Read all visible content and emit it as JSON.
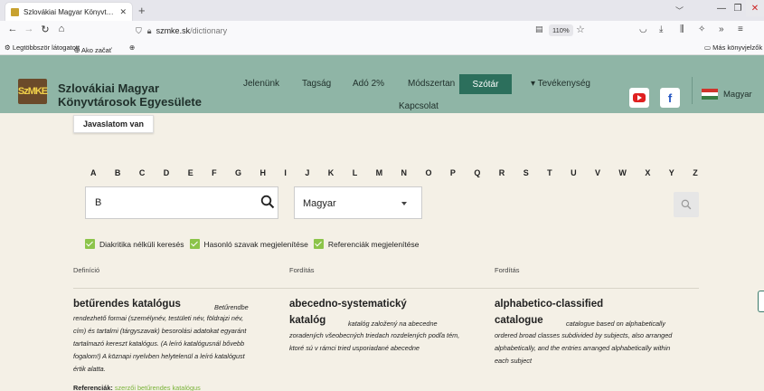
{
  "browser": {
    "tab_title": "Szlovákiai Magyar Könyvtárosok Egyesülete",
    "url_host": "szmke.sk",
    "url_path": "/dictionary",
    "zoom": "110%",
    "bookmarks": [
      "Legtöbbször látogatott",
      "Ako začať",
      "Más könyvjelzők"
    ]
  },
  "site": {
    "logo_text": "SzMKE",
    "name_line1": "Szlovákiai Magyar",
    "name_line2": "Könyvtárosok Egyesülete",
    "menu": {
      "jelenunk": "Jelenünk",
      "tagsag": "Tagság",
      "ado": "Adó 2%",
      "modszertan": "Módszertan",
      "szotar": "Szótár",
      "tevekenyseg": "▾ Tevékenység",
      "kapcsolat": "Kapcsolat"
    },
    "language": "Magyar",
    "colors": {
      "header_bg": "#8fb5a6",
      "active_menu": "#2c6f5c",
      "accent_green": "#8cc44a"
    }
  },
  "dictionary": {
    "suggest_label": "Javaslatom van",
    "alphabet": [
      "A",
      "B",
      "C",
      "D",
      "E",
      "F",
      "G",
      "H",
      "I",
      "J",
      "K",
      "L",
      "M",
      "N",
      "O",
      "P",
      "Q",
      "R",
      "S",
      "T",
      "U",
      "V",
      "W",
      "X",
      "Y",
      "Z"
    ],
    "search_value": "B",
    "language_select": "Magyar",
    "options": [
      "Diakritika nélküli keresés",
      "Hasonló szavak megjelenítése",
      "Referenciák megjelenítése"
    ],
    "columns": [
      "Definíció",
      "Fordítás",
      "Fordítás"
    ],
    "entry": {
      "col1_term": "betűrendes katalógus",
      "col1_text_a": "Betűrendbe",
      "col1_text_b": "rendezhető formai (személynév, testületi név, földrajzi név,",
      "col1_text_c": "cím) és tartalmi (tárgyszavak) besorolási adatokat egyaránt",
      "col1_text_d": "tartalmazó kereszt katalógus. (A leíró katalógusnál bővebb",
      "col1_text_e": "fogalom!) A köznapi nyelvben helytelenül a leíró katalógust",
      "col1_text_f": "értik alatta.",
      "col2_term_a": "abecedno-systematický",
      "col2_term_b": "katalóg",
      "col2_text_a": "katalóg založený na abecedne",
      "col2_text_b": "zoradených všeobecných triedach rozdelených podľa tém,",
      "col2_text_c": "ktoré sú v rámci tried usporiadané abecedne",
      "col3_term_a": "alphabetico-classified",
      "col3_term_b": "catalogue",
      "col3_text_a": "catalogue based on alphabetically",
      "col3_text_b": "ordered broad classes subdivided by subjects, also arranged",
      "col3_text_c": "alphabetically, and the entries arranged alphabetically within",
      "col3_text_d": "each subject",
      "refs_label": "Referenciák:",
      "refs_link": "szerzői betűrendes katalógus"
    }
  }
}
